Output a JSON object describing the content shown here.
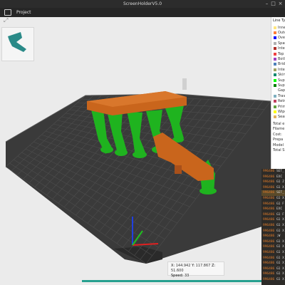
{
  "window": {
    "title": "ScreenHolderV5.0"
  },
  "menubar": {
    "tab_label": "Project"
  },
  "colors": {
    "bed": "#3a3a3a",
    "bed_grid": "#555555",
    "model_orange": "#c9651c",
    "support_green": "#1fc21f",
    "accent": "#27a090"
  },
  "legend": {
    "header": "Line Ty",
    "items": [
      {
        "label": "Inne",
        "color": "#ffe680"
      },
      {
        "label": "Oute",
        "color": "#ff7d38"
      },
      {
        "label": "Ove",
        "color": "#0000ff"
      },
      {
        "label": "Spar",
        "color": "#b0b0b0"
      },
      {
        "label": "Inter",
        "color": "#b03029"
      },
      {
        "label": "Top",
        "color": "#f04040"
      },
      {
        "label": "Botl",
        "color": "#a040c0"
      },
      {
        "label": "Brid",
        "color": "#4d80ba"
      },
      {
        "label": "Inter",
        "color": "#a0a060"
      },
      {
        "label": "Skirt",
        "color": "#00876e"
      },
      {
        "label": "Supp",
        "color": "#00ff00"
      },
      {
        "label": "Supp",
        "color": "#008000"
      },
      {
        "label": "Gap",
        "color": "#ffffff"
      },
      {
        "label": "Trav",
        "color": "#80b0c0"
      },
      {
        "label": "Retr",
        "color": "#c04060"
      },
      {
        "label": "Prim",
        "color": "#60a040"
      },
      {
        "label": "Wipe",
        "color": "#ffff00"
      },
      {
        "label": "Seam",
        "color": "#e0b060"
      }
    ]
  },
  "stats": {
    "header": "Total e",
    "rows": [
      "Filame",
      "Cost:",
      "Prepa",
      "Model",
      "Total S"
    ]
  },
  "gcode": {
    "lines": [
      {
        "ln": "996486",
        "code": " SET_"
      },
      {
        "ln": "996486",
        "code": " EXC"
      },
      {
        "ln": "996486",
        "code": " G1 Z"
      },
      {
        "ln": "996486",
        "code": " G1 X"
      },
      {
        "ln": "996486",
        "code": " SET_"
      },
      {
        "ln": "996486",
        "code": " G1 X"
      },
      {
        "ln": "996486",
        "code": " G1 F"
      },
      {
        "ln": "996486",
        "code": " EXC"
      },
      {
        "ln": "996486",
        "code": " G1 F"
      },
      {
        "ln": "996486",
        "code": " G1 X"
      },
      {
        "ln": "996486",
        "code": " G1 X"
      },
      {
        "ln": "996486",
        "code": " G1 X"
      },
      {
        "ln": "996486",
        "code": " ;W"
      },
      {
        "ln": "996486",
        "code": " G1 X"
      },
      {
        "ln": "996486",
        "code": " G1 X"
      },
      {
        "ln": "996486",
        "code": " G1 X"
      },
      {
        "ln": "996486",
        "code": " G1 X"
      },
      {
        "ln": "996486",
        "code": " G1 X"
      },
      {
        "ln": "996486",
        "code": " G1 X"
      },
      {
        "ln": "996486",
        "code": " G1 X"
      },
      {
        "ln": "996486",
        "code": " G1 X"
      }
    ]
  },
  "position": {
    "x_label": "X:",
    "x_value": "144.942",
    "y_label": "Y:",
    "y_value": "117.867",
    "z_label": "Z:",
    "z_value": "51.600",
    "speed_label": "Speed:",
    "speed_value": "33"
  },
  "progress": {
    "fraction": 1.0
  }
}
